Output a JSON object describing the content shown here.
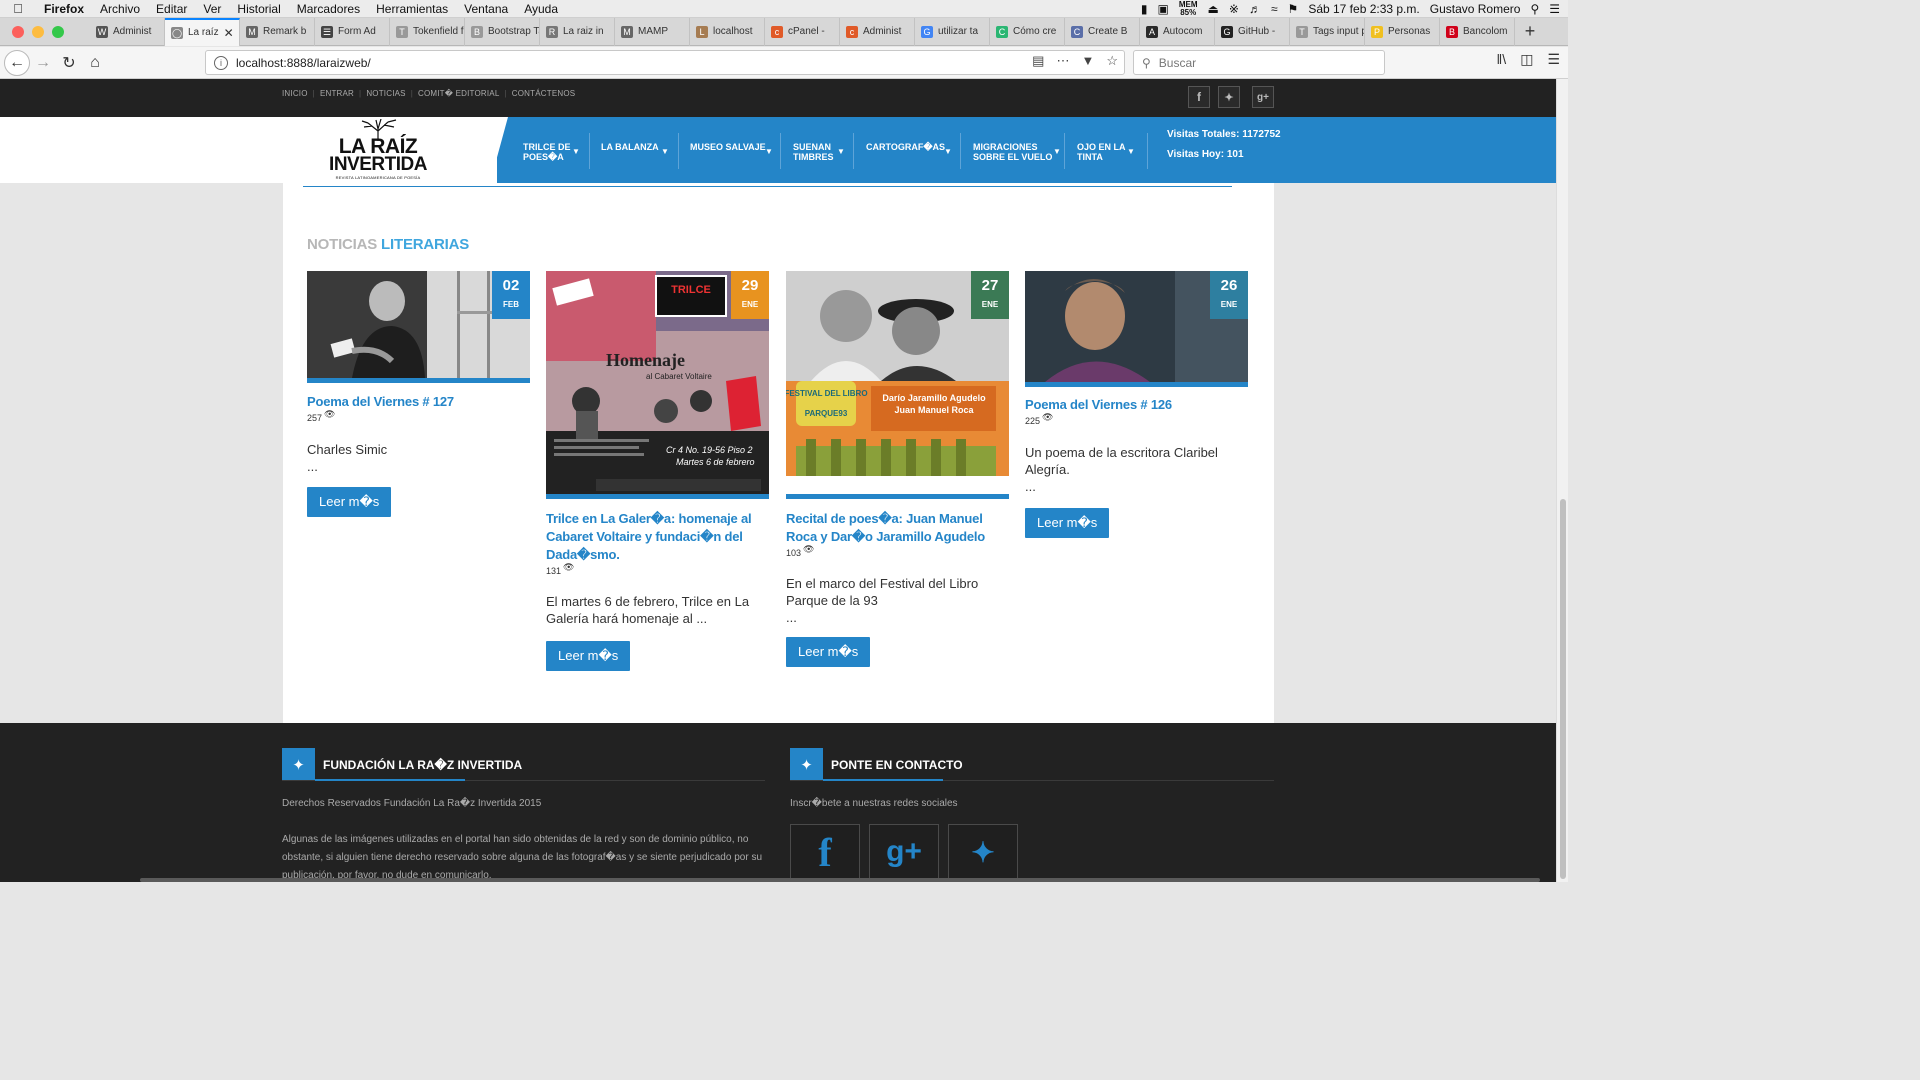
{
  "menubar": {
    "app": "Firefox",
    "items": [
      "Archivo",
      "Editar",
      "Ver",
      "Historial",
      "Marcadores",
      "Herramientas",
      "Ventana",
      "Ayuda"
    ],
    "mem_top": "MEM",
    "mem_val": "85%",
    "clock": "Sáb 17 feb  2:33 p.m.",
    "user": "Gustavo Romero"
  },
  "tabs": [
    {
      "label": "Administ",
      "fav": "W",
      "color": "#555555"
    },
    {
      "label": "La raíz",
      "fav": "◯",
      "color": "#888888"
    },
    {
      "label": "Remark b",
      "fav": "M",
      "color": "#666666"
    },
    {
      "label": "Form Ad",
      "fav": "☰",
      "color": "#444444"
    },
    {
      "label": "Tokenfield fo",
      "fav": "T",
      "color": "#999999"
    },
    {
      "label": "Bootstrap Ta",
      "fav": "B",
      "color": "#999999"
    },
    {
      "label": "La raiz in",
      "fav": "R",
      "color": "#777777"
    },
    {
      "label": "MAMP",
      "fav": "M",
      "color": "#666666"
    },
    {
      "label": "localhost",
      "fav": "L",
      "color": "#a67c52"
    },
    {
      "label": "cPanel -",
      "fav": "c",
      "color": "#e05a28"
    },
    {
      "label": "Administ",
      "fav": "c",
      "color": "#e05a28"
    },
    {
      "label": "utilizar ta",
      "fav": "G",
      "color": "#4285f4"
    },
    {
      "label": "Cómo cre",
      "fav": "C",
      "color": "#2bb673"
    },
    {
      "label": "Create B",
      "fav": "C",
      "color": "#5a6ea8"
    },
    {
      "label": "Autocom",
      "fav": "A",
      "color": "#2a2a2a"
    },
    {
      "label": "GitHub -",
      "fav": "G",
      "color": "#222222"
    },
    {
      "label": "Tags input plu",
      "fav": "T",
      "color": "#999999"
    },
    {
      "label": "Personas",
      "fav": "P",
      "color": "#f0c020"
    },
    {
      "label": "Bancolom",
      "fav": "B",
      "color": "#d0021b"
    }
  ],
  "browser": {
    "url": "localhost:8888/laraizweb/",
    "search_placeholder": "Buscar"
  },
  "site": {
    "toplinks": [
      "INICIO",
      "ENTRAR",
      "NOTICIAS",
      "COMIT� EDITORIAL",
      "CONTÁCTENOS"
    ],
    "logo_line1": "LA RAÍZ",
    "logo_line2": "INVERTIDA",
    "logo_line3": "REVISTA LATINOAMERICANA DE POESÍA",
    "menu": [
      {
        "line1": "TRILCE DE",
        "line2": "POES�A"
      },
      {
        "line1": "LA BALANZA",
        "line2": ""
      },
      {
        "line1": "MUSEO SALVAJE",
        "line2": ""
      },
      {
        "line1": "SUENAN",
        "line2": "TIMBRES"
      },
      {
        "line1": "CARTOGRAF�AS",
        "line2": ""
      },
      {
        "line1": "MIGRACIONES",
        "line2": "SOBRE EL VUELO"
      },
      {
        "line1": "OJO EN LA",
        "line2": "TINTA"
      }
    ],
    "visits_total": "Visitas Totales: 1172752",
    "visits_today": "Visitas Hoy: 101",
    "section_a": "NOTICIAS",
    "section_b": "LITERARIAS",
    "read_more": "Leer m�s",
    "cards": [
      {
        "day": "02",
        "month": "FEB",
        "title": "Poema del Viernes # 127",
        "views": "257",
        "excerpt": "Charles Simic",
        "dots": "...",
        "box_color": "#2485c8"
      },
      {
        "day": "29",
        "month": "ENE",
        "title": "Trilce en La Galer�a: homenaje al Cabaret Voltaire y fundaci�n del Dada�smo.",
        "views": "131",
        "excerpt": "El martes 6 de febrero, Trilce en La Galería hará homenaje al ...",
        "dots": "",
        "box_color": "#e8931f",
        "img_text1": "TRILCE",
        "img_text2": "Homenaje",
        "img_text3": "al Cabaret Voltaire",
        "img_text4": "Cr 4 No. 19-56 Piso 2",
        "img_text5": "Martes 6 de febrero"
      },
      {
        "day": "27",
        "month": "ENE",
        "title": "Recital de poes�a: Juan Manuel Roca y Dar�o Jaramillo Agudelo",
        "views": "103",
        "excerpt": "En el marco del Festival del Libro Parque de la 93",
        "dots": "...",
        "box_color": "#3b7a55",
        "img_text1": "FESTIVAL DEL LIBRO",
        "img_text2": "PARQUE93",
        "img_text3": "Darío Jaramillo Agudelo",
        "img_text4": "Juan Manuel Roca"
      },
      {
        "day": "26",
        "month": "ENE",
        "title": "Poema del Viernes # 126",
        "views": "225",
        "excerpt": "Un poema de la escritora Claribel Alegría.",
        "dots": "...",
        "box_color": "#2e7fa0"
      }
    ],
    "footer": {
      "left_title": "FUNDACIÓN LA RA�Z INVERTIDA",
      "rights": "Derechos Reservados Fundación La Ra�z Invertida 2015",
      "disclaimer": "Algunas de las imágenes utilizadas en el portal han sido obtenidas de la red y son de dominio público, no obstante, si alguien tiene derecho reservado sobre alguna de las fotograf�as y se siente perjudicado por su publicación, por favor, no dude en comunicarlo.",
      "right_title": "PONTE EN CONTACTO",
      "subscribe": "Inscr�bete a nuestras redes sociales"
    }
  }
}
